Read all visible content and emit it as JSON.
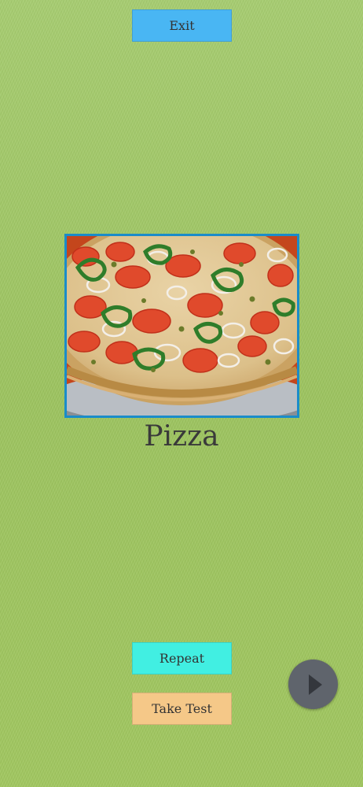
{
  "buttons": {
    "exit_label": "Exit",
    "repeat_label": "Repeat",
    "test_label": "Take Test"
  },
  "flashcard": {
    "word": "Pizza",
    "image_subject": "pizza-photo"
  },
  "media": {
    "play_icon": "play-icon"
  },
  "colors": {
    "background": "#9fc565",
    "exit_button": "#49b6f3",
    "repeat_button": "#41efe2",
    "test_button": "#f5c888",
    "image_border": "#1a8cc9",
    "play_button": "#5f646c"
  }
}
